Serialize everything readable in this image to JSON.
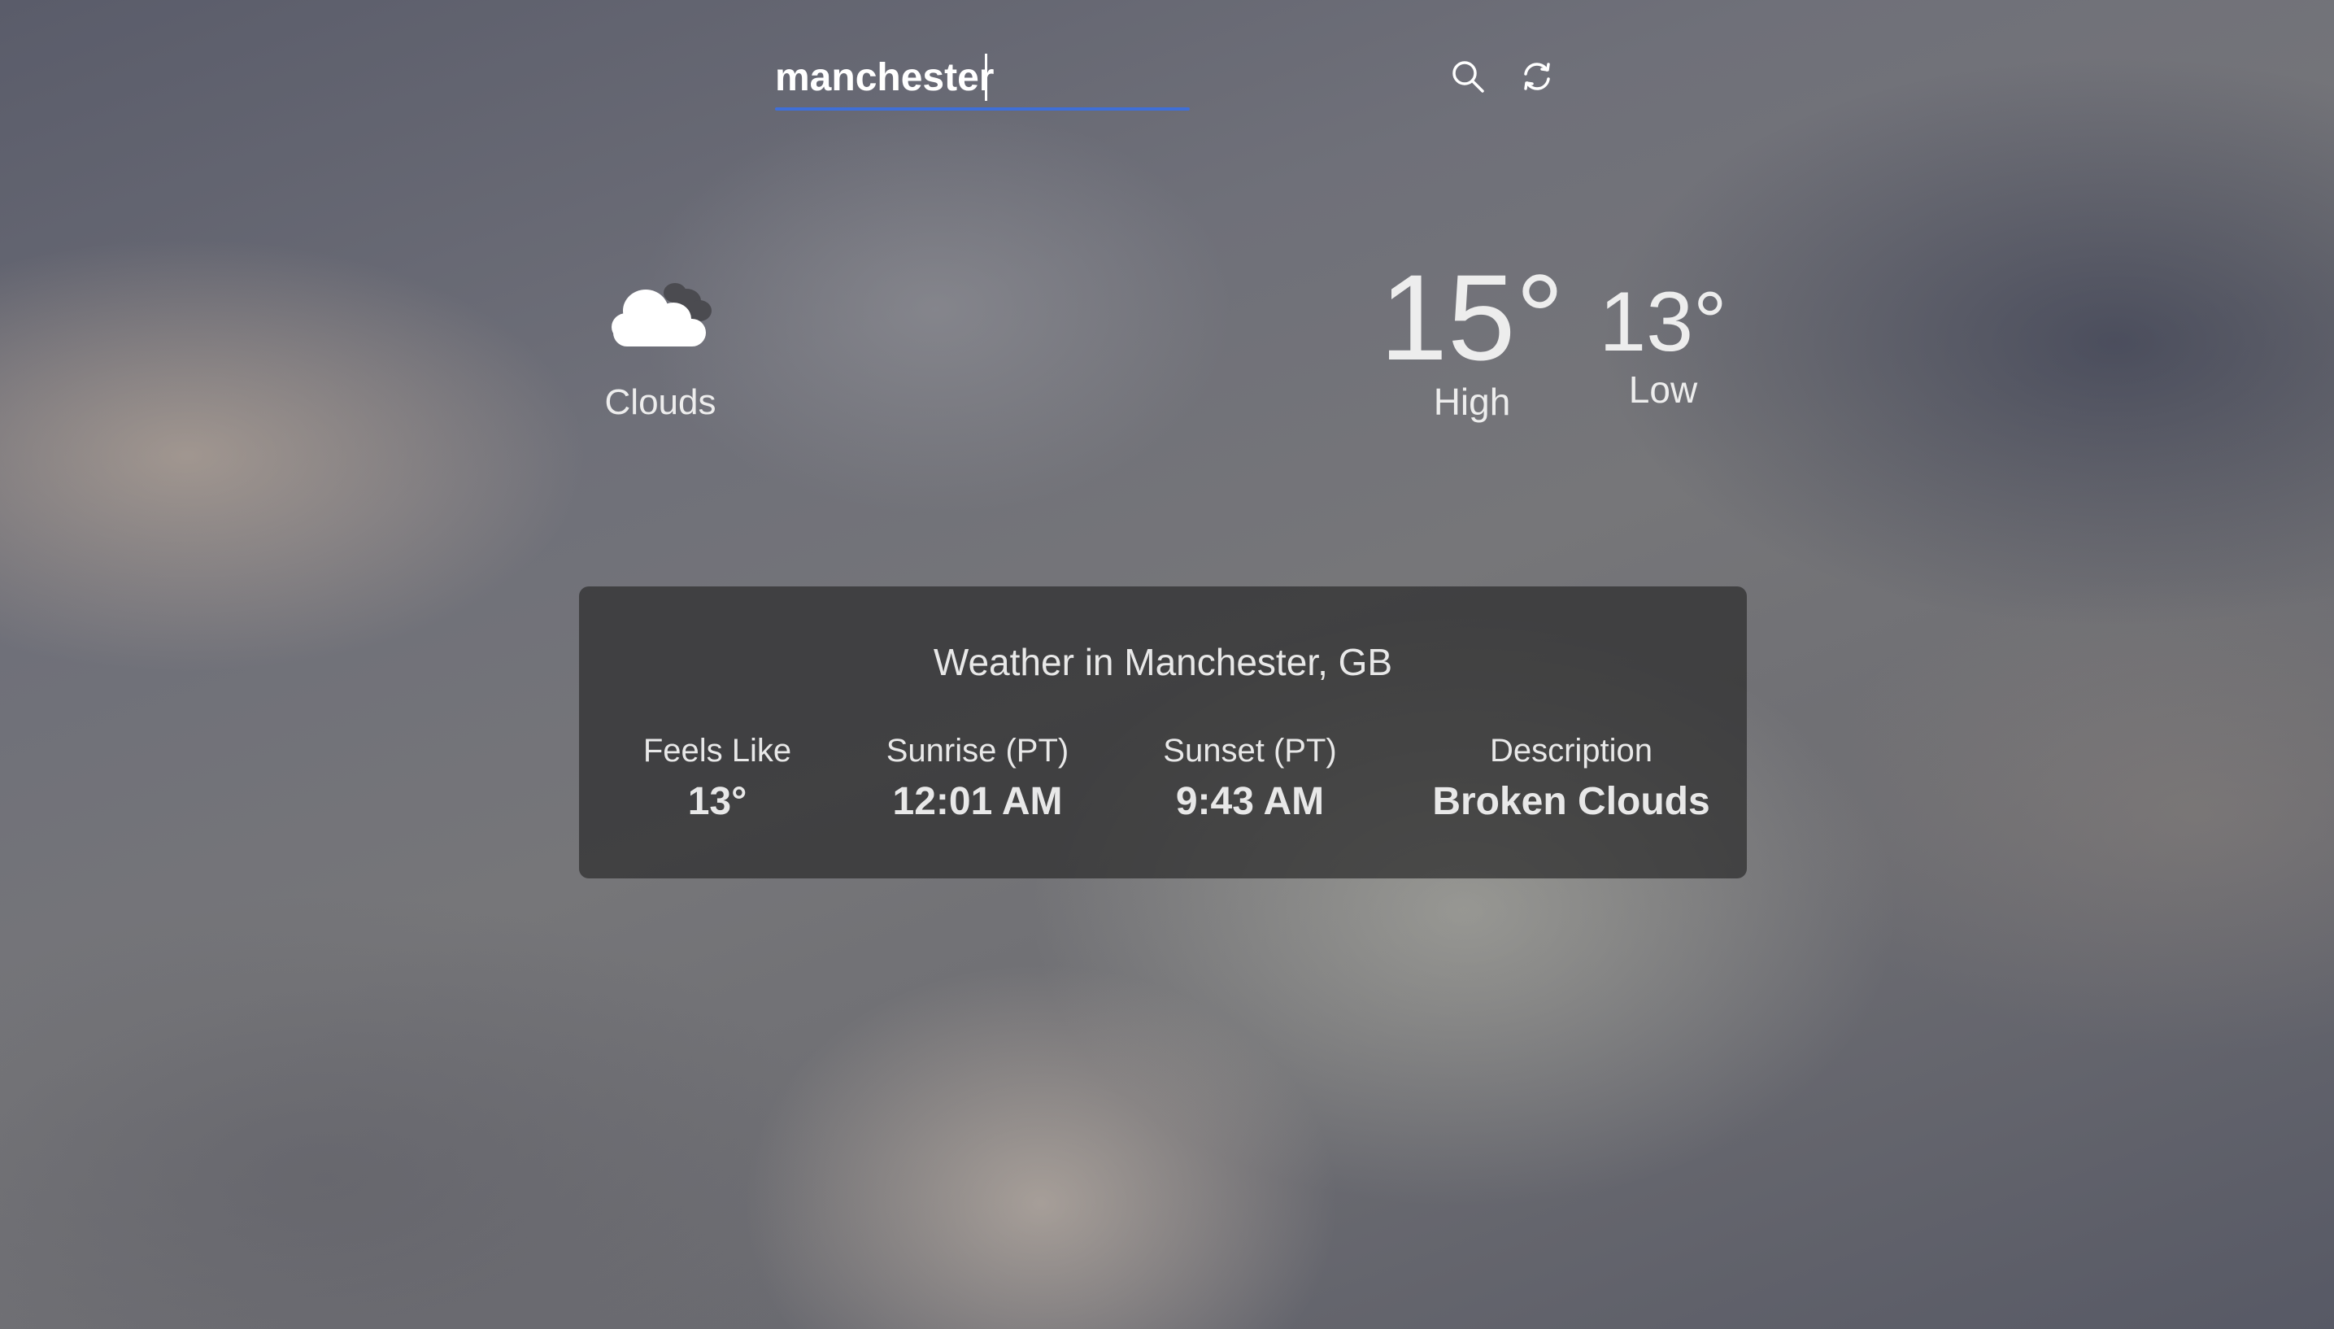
{
  "search": {
    "value": "manchester",
    "search_icon": "search-icon",
    "refresh_icon": "refresh-icon"
  },
  "condition": {
    "icon": "cloud-icon",
    "label": "Clouds"
  },
  "temps": {
    "high_value": "15°",
    "high_label": "High",
    "low_value": "13°",
    "low_label": "Low"
  },
  "panel": {
    "title": "Weather in Manchester, GB",
    "stats": [
      {
        "label": "Feels Like",
        "value": "13°"
      },
      {
        "label": "Sunrise (PT)",
        "value": "12:01 AM"
      },
      {
        "label": "Sunset (PT)",
        "value": "9:43 AM"
      },
      {
        "label": "Description",
        "value": "Broken Clouds"
      }
    ]
  },
  "colors": {
    "accent_underline": "#3f6fd8",
    "panel_bg": "#2d2d2d",
    "text": "#ededed"
  }
}
